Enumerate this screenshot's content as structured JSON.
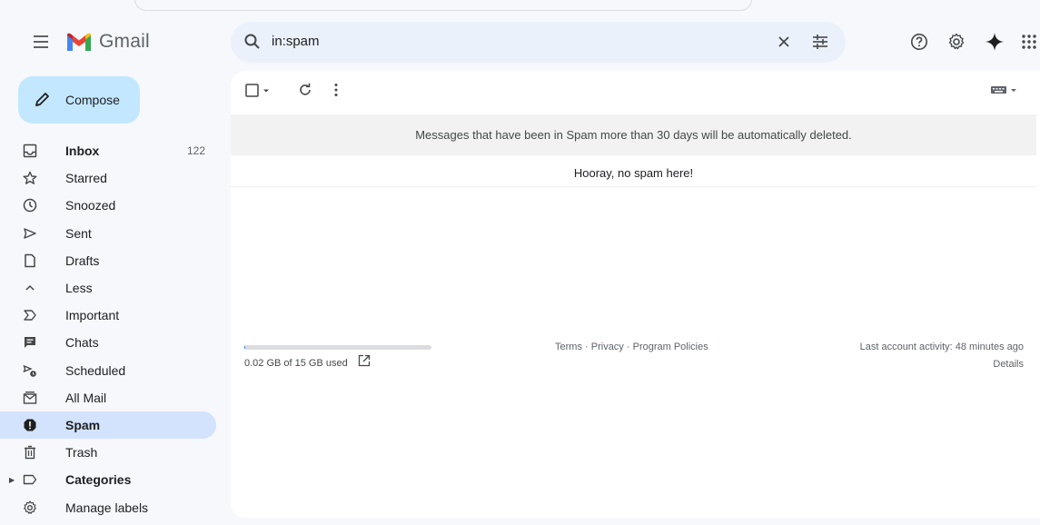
{
  "app": {
    "name": "Gmail"
  },
  "search": {
    "query": "in:spam"
  },
  "compose": {
    "label": "Compose"
  },
  "sidebar": {
    "items": [
      {
        "label": "Inbox",
        "count": "122",
        "icon": "inbox-icon",
        "bold": true
      },
      {
        "label": "Starred",
        "icon": "star-icon"
      },
      {
        "label": "Snoozed",
        "icon": "clock-icon"
      },
      {
        "label": "Sent",
        "icon": "send-icon"
      },
      {
        "label": "Drafts",
        "icon": "draft-icon"
      },
      {
        "label": "Less",
        "icon": "chevron-up-icon"
      },
      {
        "label": "Important",
        "icon": "important-icon"
      },
      {
        "label": "Chats",
        "icon": "chat-icon"
      },
      {
        "label": "Scheduled",
        "icon": "scheduled-send-icon"
      },
      {
        "label": "All Mail",
        "icon": "all-mail-icon"
      },
      {
        "label": "Spam",
        "icon": "spam-icon",
        "active": true,
        "bold": true
      },
      {
        "label": "Trash",
        "icon": "trash-icon"
      },
      {
        "label": "Categories",
        "icon": "label-icon",
        "bold": true
      },
      {
        "label": "Manage labels",
        "icon": "gear-icon"
      }
    ]
  },
  "main": {
    "banner": "Messages that have been in Spam more than 30 days will be automatically deleted.",
    "empty_message": "Hooray, no spam here!"
  },
  "footer": {
    "storage": "0.02 GB of 15 GB used",
    "storage_fraction": 0.0013,
    "terms": "Terms",
    "separator": "·",
    "privacy": "Privacy",
    "policies": "Program Policies",
    "activity": "Last account activity: 48 minutes ago",
    "details": "Details"
  },
  "colors": {
    "accent": "#1a73e8",
    "compose_bg": "#c2e7ff",
    "active_nav": "#d3e3fd",
    "search_bg": "#eaf1fb",
    "page_bg": "#f6f8fc"
  }
}
